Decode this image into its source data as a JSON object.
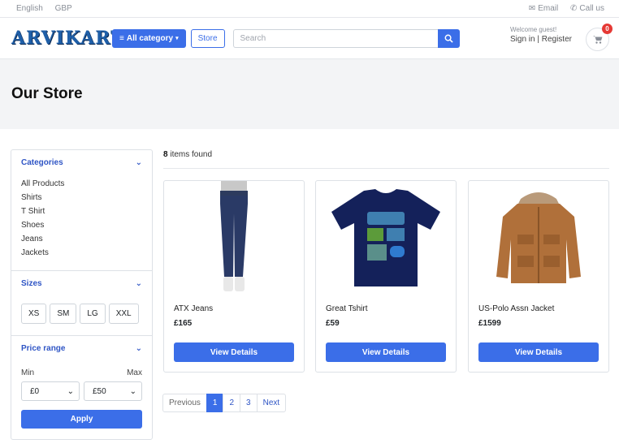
{
  "topbar": {
    "language": "English",
    "currency": "GBP",
    "email": "Email",
    "call": "Call us"
  },
  "header": {
    "logo": "ARVIKART",
    "all_category": "All category",
    "store": "Store",
    "search_placeholder": "Search",
    "welcome": "Welcome guest!",
    "sign_in": "Sign in",
    "register": "Register",
    "cart_count": "0"
  },
  "page_title": "Our Store",
  "sidebar": {
    "categories_title": "Categories",
    "categories": [
      "All Products",
      "Shirts",
      "T Shirt",
      "Shoes",
      "Jeans",
      "Jackets"
    ],
    "sizes_title": "Sizes",
    "sizes": [
      "XS",
      "SM",
      "LG",
      "XXL"
    ],
    "price_title": "Price range",
    "min_label": "Min",
    "max_label": "Max",
    "min_value": "£0",
    "max_value": "£50",
    "apply": "Apply"
  },
  "results": {
    "count": "8",
    "label": "items found"
  },
  "products": [
    {
      "name": "ATX Jeans",
      "price": "£165",
      "button": "View Details"
    },
    {
      "name": "Great Tshirt",
      "price": "£59",
      "button": "View Details"
    },
    {
      "name": "US-Polo Assn Jacket",
      "price": "£1599",
      "button": "View Details"
    }
  ],
  "pagination": {
    "prev": "Previous",
    "pages": [
      "1",
      "2",
      "3"
    ],
    "next": "Next",
    "active": "1"
  },
  "colors": {
    "accent": "#3b6ee8",
    "badge": "#e53935",
    "hero_bg": "#f3f4f6"
  }
}
